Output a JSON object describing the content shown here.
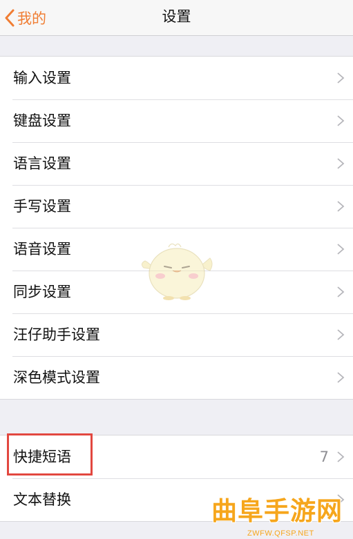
{
  "nav": {
    "back_label": "我的",
    "title": "设置"
  },
  "groups": [
    {
      "rows": [
        {
          "label": "输入设置"
        },
        {
          "label": "键盘设置"
        },
        {
          "label": "语言设置"
        },
        {
          "label": "手写设置"
        },
        {
          "label": "语音设置"
        },
        {
          "label": "同步设置"
        },
        {
          "label": "汪仔助手设置"
        },
        {
          "label": "深色模式设置"
        }
      ]
    },
    {
      "rows": [
        {
          "label": "快捷短语",
          "value": "7"
        },
        {
          "label": "文本替换"
        }
      ]
    }
  ],
  "watermark": {
    "text": "曲阜手游网",
    "url": "ZWFW.QFSP.NET"
  },
  "icons": {
    "back": "chevron-left-icon",
    "row": "chevron-right-icon",
    "mascot": "mascot-chick-icon"
  },
  "colors": {
    "accent": "#f07d33",
    "highlight": "#e2473f",
    "watermark": "#f6a61c",
    "background": "#efeff4"
  }
}
